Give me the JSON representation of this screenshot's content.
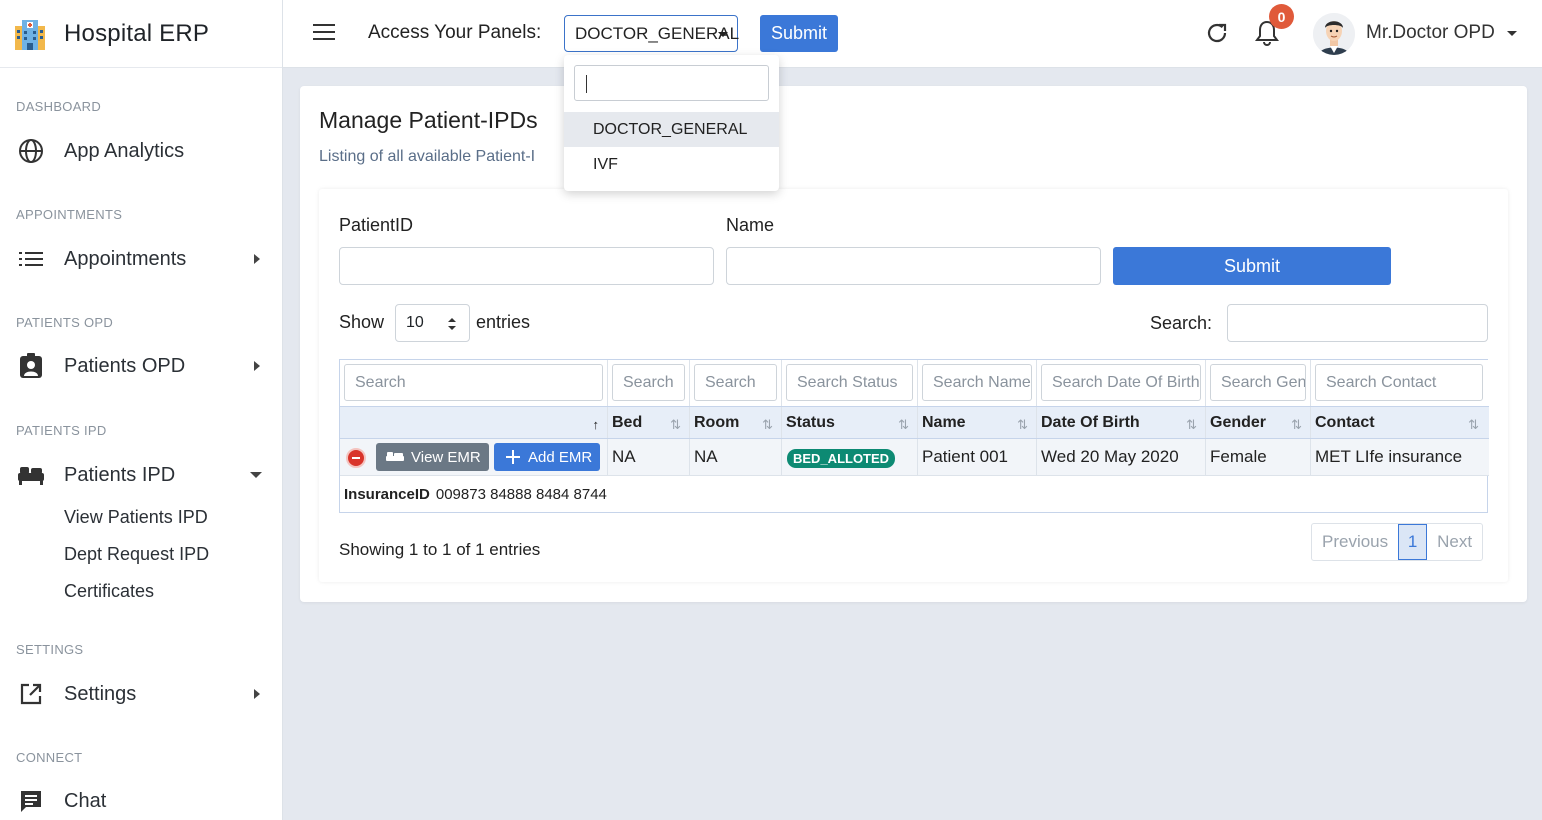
{
  "brand": {
    "title": "Hospital ERP",
    "logo_icon": "hospital-icon"
  },
  "sidebar": {
    "sections": [
      {
        "label": "DASHBOARD"
      },
      {
        "label": "APPOINTMENTS"
      },
      {
        "label": "PATIENTS OPD"
      },
      {
        "label": "PATIENTS IPD"
      },
      {
        "label": "SETTINGS"
      },
      {
        "label": "CONNECT"
      }
    ],
    "items": [
      {
        "label": "App Analytics",
        "icon": "globe-icon"
      },
      {
        "label": "Appointments",
        "icon": "list-icon"
      },
      {
        "label": "Patients OPD",
        "icon": "clipboard-user-icon"
      },
      {
        "label": "Patients IPD",
        "icon": "bed-icon"
      },
      {
        "label": "Settings",
        "icon": "external-link-icon"
      },
      {
        "label": "Chat",
        "icon": "chat-icon"
      }
    ],
    "ipd_subitems": [
      {
        "label": "View Patients IPD"
      },
      {
        "label": "Dept Request IPD"
      },
      {
        "label": "Certificates"
      }
    ]
  },
  "topbar": {
    "panels_label": "Access Your Panels:",
    "panel_selected": "DOCTOR_GENERAL",
    "submit_label": "Submit",
    "notification_count": "0",
    "user_name": "Mr.Doctor OPD"
  },
  "panel_dropdown": {
    "search_value": "",
    "options": [
      {
        "label": "DOCTOR_GENERAL",
        "selected": true
      },
      {
        "label": "IVF",
        "selected": false
      }
    ]
  },
  "page": {
    "title": "Manage Patient-IPDs",
    "subtitle": "Listing of all available Patient-I"
  },
  "filters": {
    "patient_id_label": "PatientID",
    "patient_id_value": "",
    "name_label": "Name",
    "name_value": "",
    "submit_label": "Submit"
  },
  "table_controls": {
    "show_label": "Show",
    "entries_value": "10",
    "entries_label": "entries",
    "search_label": "Search:",
    "search_value": ""
  },
  "table": {
    "column_search_placeholders": [
      "Search",
      "Search",
      "Search",
      "Search Status",
      "Search Name",
      "Search Date Of Birth",
      "Search Gender",
      "Search Contact"
    ],
    "headers": [
      "",
      "Bed",
      "Room",
      "Status",
      "Name",
      "Date Of Birth",
      "Gender",
      "Contact"
    ],
    "rows": [
      {
        "view_emr_label": "View EMR",
        "add_emr_label": "Add EMR",
        "bed": "NA",
        "room": "NA",
        "status": "BED_ALLOTED",
        "name": "Patient 001",
        "dob": "Wed 20 May 2020",
        "gender": "Female",
        "contact": "MET LIfe insurance",
        "child": {
          "label": "InsuranceID",
          "value": "009873 84888 8484 8744"
        }
      }
    ]
  },
  "footer": {
    "info": "Showing 1 to 1 of 1 entries",
    "previous": "Previous",
    "page": "1",
    "next": "Next"
  },
  "colors": {
    "primary": "#3b78d8",
    "status_green": "#0d8a73",
    "badge_red": "#e05a3a",
    "danger": "#d9342b"
  }
}
